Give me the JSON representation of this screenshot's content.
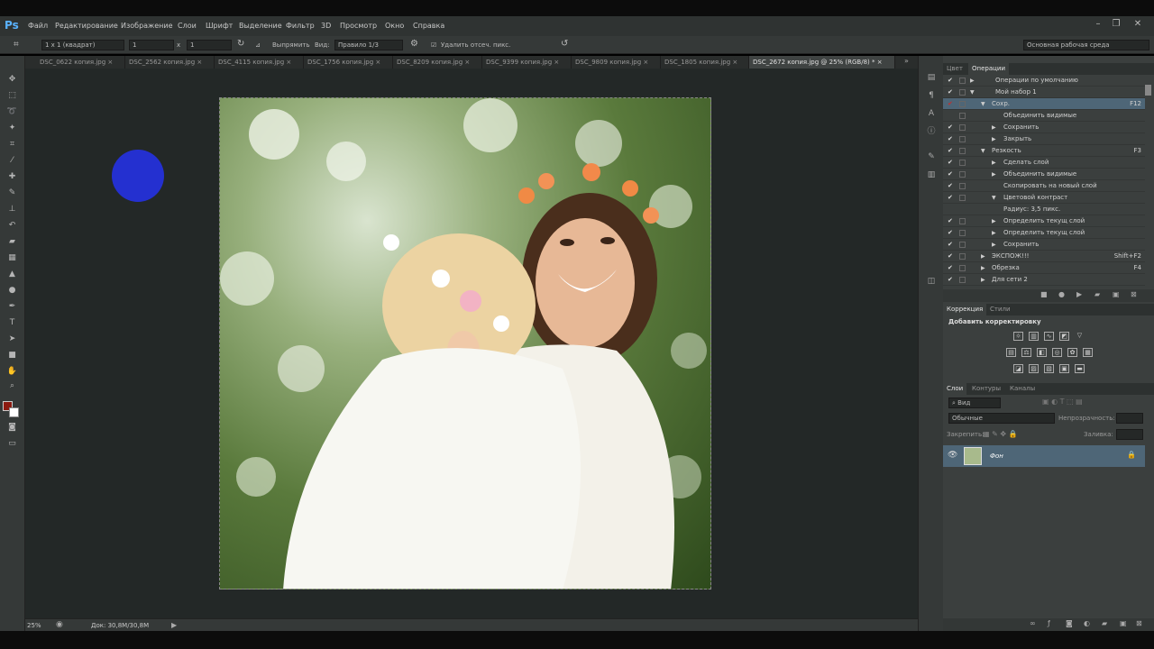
{
  "app": {
    "logo": "Ps"
  },
  "menu": [
    "Файл",
    "Редактирование",
    "Изображение",
    "Слои",
    "Шрифт",
    "Выделение",
    "Фильтр",
    "3D",
    "Просмотр",
    "Окно",
    "Справка"
  ],
  "options": {
    "ratio": "1 x 1 (квадрат)",
    "width": "1",
    "times": "x",
    "height": "1",
    "straighten": "Выпрямить",
    "view_label": "Вид:",
    "view_value": "Правило 1/3",
    "delete_cropped": "Удалить отсеч. пикс.",
    "workspace": "Основная рабочая среда"
  },
  "tabs": [
    "DSC_0622 копия.jpg",
    "DSC_2562 копия.jpg",
    "DSC_4115 копия.jpg",
    "DSC_1756 копия.jpg",
    "DSC_8209 копия.jpg",
    "DSC_9399 копия.jpg",
    "DSC_9809 копия.jpg",
    "DSC_1805 копия.jpg",
    "DSC_2672 копия.jpg @ 25% (RGB/8) *"
  ],
  "status": {
    "zoom": "25%",
    "doc": "Док: 30,8M/30,8M"
  },
  "actions_panel": {
    "tabs": [
      "Цвет",
      "Операции"
    ],
    "rows": [
      {
        "label": "Операции по умолчанию",
        "key": ""
      },
      {
        "label": "Мой набор 1",
        "key": ""
      },
      {
        "label": "Сохр.",
        "key": "F12"
      },
      {
        "label": "Объединить видимые",
        "key": ""
      },
      {
        "label": "Сохранить",
        "key": ""
      },
      {
        "label": "Закрыть",
        "key": ""
      },
      {
        "label": "Резкость",
        "key": "F3"
      },
      {
        "label": "Сделать слой",
        "key": ""
      },
      {
        "label": "Объединить видимые",
        "key": ""
      },
      {
        "label": "Скопировать на новый слой",
        "key": ""
      },
      {
        "label": "Цветовой контраст",
        "key": ""
      },
      {
        "label": "Радиус: 3,5 пикс.",
        "key": ""
      },
      {
        "label": "Определить текущ слой",
        "key": ""
      },
      {
        "label": "Определить текущ слой",
        "key": ""
      },
      {
        "label": "Сохранить",
        "key": ""
      },
      {
        "label": "ЭКСПОЖ!!!",
        "key": "Shift+F2"
      },
      {
        "label": "Обрезка",
        "key": "F4"
      },
      {
        "label": "Для сети 2",
        "key": ""
      }
    ]
  },
  "adjust_panel": {
    "tabs": [
      "Коррекция",
      "Стили"
    ],
    "title": "Добавить корректировку"
  },
  "layers_panel": {
    "tabs": [
      "Слои",
      "Контуры",
      "Каналы"
    ],
    "kind": "Вид",
    "blend": "Обычные",
    "opacity_label": "Непрозрачность:",
    "lock_label": "Закрепить:",
    "fill_label": "Заливка:",
    "layer_name": "Фон"
  },
  "colors": {
    "foreground": "#8b1a10",
    "background": "#ffffff",
    "cursor_dot": "#2430d0"
  }
}
